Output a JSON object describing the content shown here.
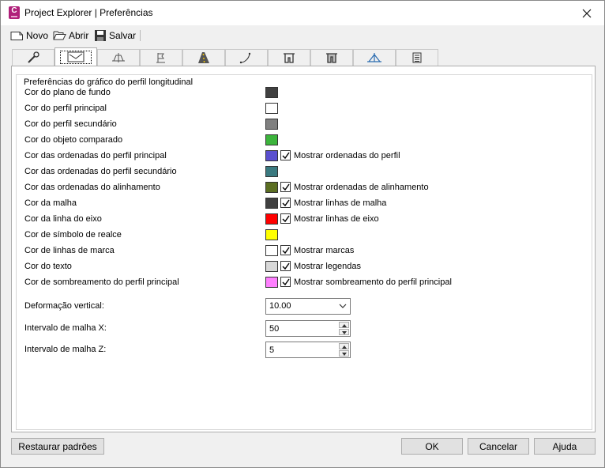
{
  "window": {
    "title": "Project Explorer | Preferências",
    "app_icon_letter": "C"
  },
  "toolbar": {
    "new_label": "Novo",
    "open_label": "Abrir",
    "save_label": "Salvar"
  },
  "tabs": [
    {
      "icon": "wrench-icon",
      "active": false
    },
    {
      "icon": "profile-graph-icon",
      "active": true
    },
    {
      "icon": "cross-section-icon",
      "active": false
    },
    {
      "icon": "flag-icon",
      "active": false
    },
    {
      "icon": "road-icon",
      "active": false
    },
    {
      "icon": "alignment-curve-icon",
      "active": false
    },
    {
      "icon": "structure-icon",
      "active": false
    },
    {
      "icon": "structure-alt-icon",
      "active": false
    },
    {
      "icon": "survey-point-icon",
      "active": false
    },
    {
      "icon": "table-icon",
      "active": false
    }
  ],
  "group": {
    "title": "Preferências do gráfico do perfil longitudinal",
    "rows": [
      {
        "label": "Cor do plano de fundo",
        "color": "#404040"
      },
      {
        "label": "Cor do perfil principal",
        "color": "#ffffff"
      },
      {
        "label": "Cor do perfil secundário",
        "color": "#808080"
      },
      {
        "label": "Cor do objeto comparado",
        "color": "#3cb43c"
      },
      {
        "label": "Cor das ordenadas do perfil principal",
        "color": "#5a4fcf",
        "check": "Mostrar ordenadas do perfil"
      },
      {
        "label": "Cor das ordenadas do perfil secundário",
        "color": "#3a7a80"
      },
      {
        "label": "Cor das ordenadas do alinhamento",
        "color": "#5b6e22",
        "check": "Mostrar ordenadas de alinhamento"
      },
      {
        "label": "Cor da malha",
        "color": "#404040",
        "check": "Mostrar linhas de malha"
      },
      {
        "label": "Cor da linha do eixo",
        "color": "#ff0000",
        "check": "Mostrar linhas de eixo"
      },
      {
        "label": "Cor de símbolo de realce",
        "color": "#ffff00"
      },
      {
        "label": "Cor de linhas de marca",
        "color": "#ffffff",
        "check": "Mostrar marcas"
      },
      {
        "label": "Cor do texto",
        "color": "#d8d8d8",
        "check": "Mostrar legendas"
      },
      {
        "label": "Cor de sombreamento do perfil principal",
        "color": "#ff80ff",
        "check": "Mostrar sombreamento do perfil principal"
      }
    ],
    "vertical_exaggeration": {
      "label": "Deformação vertical:",
      "value": "10.00"
    },
    "grid_x": {
      "label": "Intervalo de malha X:",
      "value": "50"
    },
    "grid_z": {
      "label": "Intervalo de malha Z:",
      "value": "5"
    }
  },
  "footer": {
    "restore_label": "Restaurar padrões",
    "ok_label": "OK",
    "cancel_label": "Cancelar",
    "help_label": "Ajuda"
  }
}
